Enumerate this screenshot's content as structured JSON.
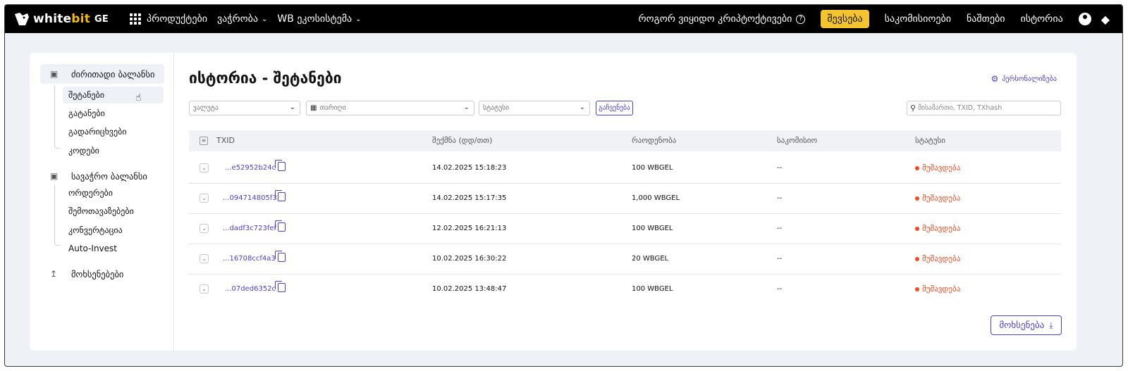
{
  "nav": {
    "logo_main": "white",
    "logo_bit": "bit",
    "logo_region": "GE",
    "products": "პროდუქტები",
    "trading": "ვაჭრობა",
    "ecosystem": "WB ეკოსისტემა",
    "how_to_buy": "როგორ ვიყიდო კრიპტოქტივები",
    "deposit": "შევსება",
    "fees": "საკომისიოები",
    "balances": "ნაშთები",
    "history": "ისტორია",
    "icons": [
      "grid-icon",
      "chevron-down-icon",
      "help-icon",
      "user-icon",
      "support-icon"
    ],
    "accent": "#f4c430"
  },
  "sidebar": {
    "main_balance": "ძირითადი ბალანსი",
    "main_items": [
      "შეტანები",
      "გატანები",
      "გადარიცხვები",
      "კოდები"
    ],
    "trade_balance": "სავაჭრო ბალანსი",
    "trade_items": [
      "ორდერები",
      "შემოთავაზებები",
      "კონვერტაცია",
      "Auto-Invest"
    ],
    "reports": "მოხსენებები"
  },
  "main": {
    "title": "ისტორია - შეტანები",
    "personalize": "პერსონალიზება",
    "filters": {
      "currency": "ვალუტა",
      "date": "თარიღი",
      "status": "სტატუსი",
      "show": "გაჩვენება",
      "search_placeholder": "მისამართი, TXID, TXhash"
    },
    "columns": [
      "TXID",
      "შექმნა (დდ/თთ)",
      "რაოდენობა",
      "საკომისიო",
      "სტატუსი"
    ],
    "rows": [
      {
        "txid": "...e52952b24c",
        "created": "14.02.2025 15:18:23",
        "amount": "100 WBGEL",
        "fee": "--",
        "status": "მუშავდება"
      },
      {
        "txid": "...094714805f3",
        "created": "14.02.2025 15:17:35",
        "amount": "1,000 WBGEL",
        "fee": "--",
        "status": "მუშავდება"
      },
      {
        "txid": "...dadf3c723fef",
        "created": "12.02.2025 16:21:13",
        "amount": "100 WBGEL",
        "fee": "--",
        "status": "მუშავდება"
      },
      {
        "txid": "...16708ccf4a3",
        "created": "10.02.2025 16:30:22",
        "amount": "20 WBGEL",
        "fee": "--",
        "status": "მუშავდება"
      },
      {
        "txid": "...07ded6352c",
        "created": "10.02.2025 13:48:47",
        "amount": "100 WBGEL",
        "fee": "--",
        "status": "მუშავდება"
      }
    ],
    "export": "მოხსენება",
    "link_color": "#4b3fd6",
    "status_color": "#f04a23"
  }
}
